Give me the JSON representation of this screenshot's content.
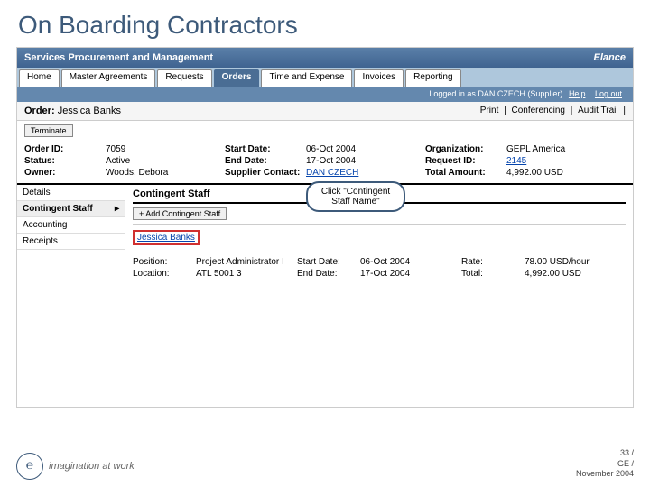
{
  "slide": {
    "title": "On Boarding Contractors",
    "page_number": "33 /",
    "company": "GE /",
    "date": "November 2004",
    "tagline": "imagination at work",
    "logo_text": "℮"
  },
  "app": {
    "title": "Services Procurement and Management",
    "brand": "Elance",
    "logged_in_text": "Logged in as DAN CZECH (Supplier)",
    "help": "Help",
    "logout": "Log out"
  },
  "tabs": [
    "Home",
    "Master Agreements",
    "Requests",
    "Orders",
    "Time and Expense",
    "Invoices",
    "Reporting"
  ],
  "active_tab": "Orders",
  "order_header": {
    "label": "Order:",
    "name": "Jessica Banks",
    "actions": [
      "Print",
      "Conferencing",
      "Audit Trail"
    ]
  },
  "terminate_label": "Terminate",
  "info": {
    "col1": [
      {
        "label": "Order ID:",
        "value": "7059"
      },
      {
        "label": "Status:",
        "value": "Active"
      },
      {
        "label": "Owner:",
        "value": "Woods, Debora"
      }
    ],
    "col2": [
      {
        "label": "Start Date:",
        "value": "06-Oct 2004"
      },
      {
        "label": "End Date:",
        "value": "17-Oct 2004"
      },
      {
        "label": "Supplier Contact:",
        "value": "DAN CZECH",
        "link": true
      }
    ],
    "col3": [
      {
        "label": "Organization:",
        "value": "GEPL America"
      },
      {
        "label": "Request ID:",
        "value": "2145",
        "link": true
      },
      {
        "label": "Total Amount:",
        "value": "4,992.00 USD"
      }
    ]
  },
  "side_menu": [
    "Details",
    "Contingent Staff",
    "Accounting",
    "Receipts"
  ],
  "side_menu_active": "Contingent Staff",
  "panel": {
    "title": "Contingent Staff",
    "add_button": "+ Add Contingent Staff",
    "staff_link": "Jessica Banks"
  },
  "callout_text": "Click \"Contingent Staff Name\"",
  "details": {
    "col1": [
      {
        "label": "Position:",
        "value": "Project Administrator I"
      },
      {
        "label": "Location:",
        "value": "ATL 5001 3"
      }
    ],
    "col2": [
      {
        "label": "Start Date:",
        "value": "06-Oct 2004"
      },
      {
        "label": "End Date:",
        "value": "17-Oct 2004"
      }
    ],
    "col3": [
      {
        "label": "Rate:",
        "value": "78.00 USD/hour"
      },
      {
        "label": "Total:",
        "value": "4,992.00 USD"
      }
    ]
  }
}
